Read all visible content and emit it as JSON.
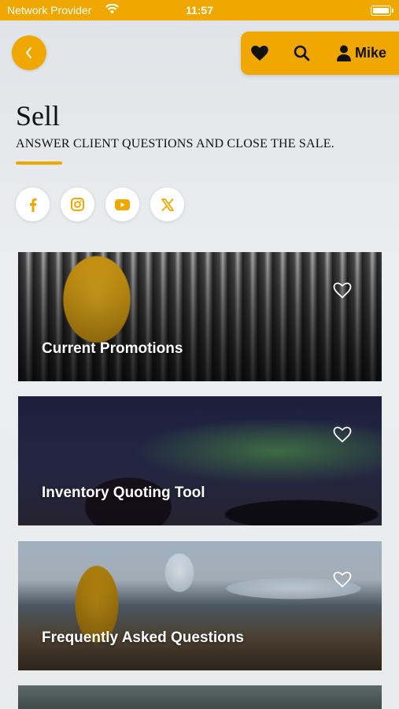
{
  "status_bar": {
    "carrier": "Network Provider",
    "time": "11:57"
  },
  "header": {
    "user_name": "Mike"
  },
  "page": {
    "title": "Sell",
    "subtitle": "ANSWER CLIENT QUESTIONS AND CLOSE THE SALE."
  },
  "social": [
    "facebook-icon",
    "instagram-icon",
    "youtube-icon",
    "x-icon"
  ],
  "cards": [
    {
      "label": "Current Promotions"
    },
    {
      "label": "Inventory Quoting Tool"
    },
    {
      "label": "Frequently Asked Questions"
    }
  ],
  "colors": {
    "accent": "#f0a800",
    "text": "#111111",
    "card_label": "#ffffff"
  }
}
